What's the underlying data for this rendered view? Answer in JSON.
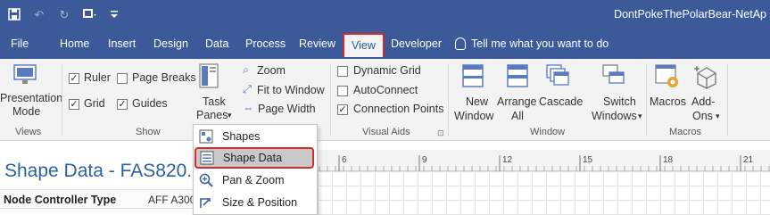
{
  "window": {
    "document_title": "DontPokeThePolarBear-NetAp"
  },
  "quick_access": {
    "icons": [
      "save-icon",
      "undo-icon",
      "redo-icon",
      "screen-icon",
      "customize-icon"
    ]
  },
  "menu_tabs": {
    "file": "File",
    "home": "Home",
    "insert": "Insert",
    "design": "Design",
    "data": "Data",
    "process": "Process",
    "review": "Review",
    "view": "View",
    "developer": "Developer",
    "tell_me": "Tell me what you want to do"
  },
  "ribbon": {
    "views": {
      "presentation_mode_line1": "Presentation",
      "presentation_mode_line2": "Mode",
      "label": "Views"
    },
    "show": {
      "ruler": "Ruler",
      "page_breaks": "Page Breaks",
      "grid": "Grid",
      "guides": "Guides",
      "task_panes_line1": "Task",
      "task_panes_line2": "Panes",
      "zoom": "Zoom",
      "fit_to_window": "Fit to Window",
      "page_width": "Page Width",
      "label": "Show"
    },
    "visual_aids": {
      "dynamic_grid": "Dynamic Grid",
      "autoconnect": "AutoConnect",
      "connection_points": "Connection Points",
      "label": "Visual Aids"
    },
    "window": {
      "new_window_line1": "New",
      "new_window_line2": "Window",
      "arrange_all_line1": "Arrange",
      "arrange_all_line2": "All",
      "cascade": "Cascade",
      "switch_windows_line1": "Switch",
      "switch_windows_line2": "Windows",
      "label": "Window"
    },
    "macros": {
      "macros": "Macros",
      "addons_line1": "Add-",
      "addons_line2": "Ons",
      "label": "Macros"
    }
  },
  "task_panes_menu": {
    "items": [
      "Shapes",
      "Shape Data",
      "Pan & Zoom",
      "Size & Position"
    ]
  },
  "ruler": {
    "ticks": [
      "6",
      "9",
      "12",
      "15",
      "18",
      "21",
      "24"
    ]
  },
  "shape_data_pane": {
    "title": "Shape Data - FAS820...",
    "row_label": "Node Controller Type",
    "row_value": "AFF A300"
  },
  "colors": {
    "title_bar": "#3c5a9a",
    "highlight": "#d62a2a",
    "accent": "#2b579a"
  }
}
